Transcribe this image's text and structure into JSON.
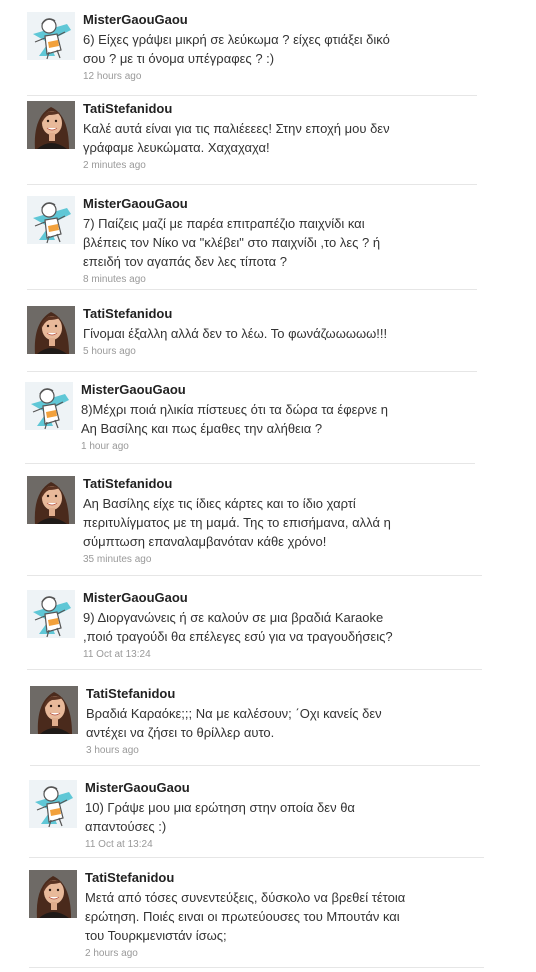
{
  "users": {
    "mister": "MisterGaouGaou",
    "tati": "TatiStefanidou"
  },
  "tweets": [
    {
      "user": "MisterGaouGaou",
      "text": "6) Είχες γράψει μικρή σε λεύκωμα ? είχες φτιάξει δικό\nσου ? με τι όνομα υπέγραφες ? :)",
      "time": "12 hours ago",
      "avatar": "cartoon-avatar"
    },
    {
      "user": "TatiStefanidou",
      "text": "Καλέ αυτά είναι για τις παλιέεεες! Στην εποχή μου δεν\nγράφαμε λευκώματα. Χαχαχαχα!",
      "time": "2 minutes ago",
      "avatar": "photo-avatar"
    },
    {
      "user": "MisterGaouGaou",
      "text": "7) Παίζεις μαζί με παρέα επιτραπέζιο παιχνίδι και\nβλέπεις τον Νίκο να \"κλέβει\" στο παιχνίδι ,το λες ? ή\nεπειδή τον αγαπάς δεν λες τίποτα ?",
      "time": "8 minutes ago",
      "avatar": "cartoon-avatar"
    },
    {
      "user": "TatiStefanidou",
      "text": "Γίνομαι έξαλλη αλλά δεν το λέω. Το φωνάζωωωωω!!!",
      "time": "5 hours ago",
      "avatar": "photo-avatar"
    },
    {
      "user": "MisterGaouGaou",
      "text": "8)Μέχρι ποιά ηλικία πίστευες ότι τα δώρα τα έφερνε η\nΑη Βασίλης και πως έμαθες την αλήθεια ?",
      "time": "1 hour ago",
      "avatar": "cartoon-avatar"
    },
    {
      "user": "TatiStefanidou",
      "text": "Αη Βασίλης είχε τις ίδιες κάρτες και το ίδιο χαρτί\nπεριτυλίγματος με τη μαμά. Της το επισήμανα, αλλά η\nσύμπτωση επαναλαμβανόταν κάθε χρόνο!",
      "time": "35 minutes ago",
      "avatar": "photo-avatar"
    },
    {
      "user": "MisterGaouGaou",
      "text": "9) Διοργανώνεις ή σε καλούν σε μια βραδιά Karaoke\n,ποιό τραγούδι θα επέλεγες εσύ για να τραγουδήσεις?",
      "time": "11 Oct at 13:24",
      "avatar": "cartoon-avatar"
    },
    {
      "user": "TatiStefanidou",
      "text": "Βραδιά Καραόκε;;; Να με καλέσουν; ΄Οχι κανείς δεν\nαντέχει να ζήσει το θρίλλερ αυτο.",
      "time": "3 hours ago",
      "avatar": "photo-avatar"
    },
    {
      "user": "MisterGaouGaou",
      "text": "10) Γράψε μου μια ερώτηση στην οποία δεν θα\nαπαντούσες :)",
      "time": "11 Oct at 13:24",
      "avatar": "cartoon-avatar"
    },
    {
      "user": "TatiStefanidou",
      "text": "Μετά από τόσες συνεντεύξεις, δύσκολο να βρεθεί τέτοια\nερώτηση. Ποιές ειναι οι πρωτεύουσες του Μπουτάν και\nτου Τουρκμενιστάν ίσως;",
      "time": "2 hours ago",
      "avatar": "photo-avatar"
    }
  ]
}
